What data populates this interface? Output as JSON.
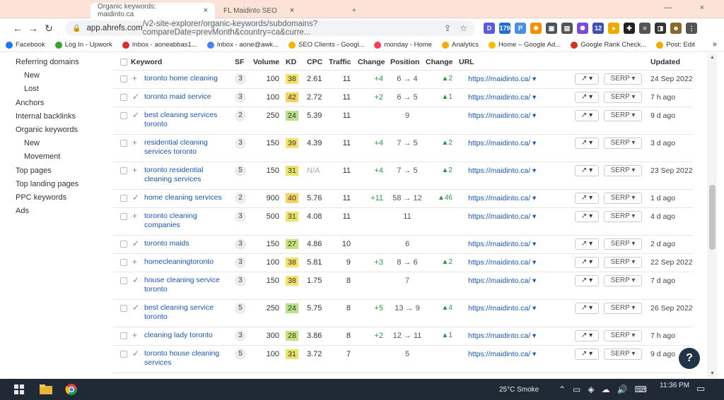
{
  "tabs": [
    {
      "label": "Organic keywords: maidinto.ca",
      "close": "×"
    },
    {
      "label": "FL Maidinto SEO",
      "close": "×"
    },
    {
      "label": "+",
      "close": ""
    }
  ],
  "window_controls": "— ×",
  "address_bar": {
    "url_main": "app.ahrefs.com",
    "url_rest": "/v2-site-explorer/organic-keywords/subdomains?compareDate=prevMonth&country=ca&curre..."
  },
  "extensions": [
    {
      "label": "D",
      "color": "#5a5ae0"
    },
    {
      "label": "179",
      "color": "#1f6fd0"
    },
    {
      "label": "P",
      "color": "#4a90e2"
    },
    {
      "label": "✱",
      "color": "#f29100"
    },
    {
      "label": "▣",
      "color": "#4a5560"
    },
    {
      "label": "▤",
      "color": "#555"
    },
    {
      "label": "✺",
      "color": "#7a4ad8"
    },
    {
      "label": "12",
      "color": "#3f51b5"
    },
    {
      "label": "●",
      "color": "#f2a900"
    },
    {
      "label": "✚",
      "color": "#222"
    },
    {
      "label": "≡",
      "color": "#555"
    },
    {
      "label": "◨",
      "color": "#333"
    },
    {
      "label": "☻",
      "color": "#8a6a2a"
    },
    {
      "label": "⋮",
      "color": "#555"
    }
  ],
  "bookmarks": [
    {
      "label": "Facebook",
      "color": "#1877f2"
    },
    {
      "label": "Log In - Upwork",
      "color": "#3aa02e"
    },
    {
      "label": "Inbox - aoneabbas1...",
      "color": "#d93025"
    },
    {
      "label": "Inbox - aone@awk...",
      "color": "#4285f4"
    },
    {
      "label": "SEO Clients - Googl...",
      "color": "#f4b400"
    },
    {
      "label": "monday - Home",
      "color": "#ff3d57"
    },
    {
      "label": "Analytics",
      "color": "#f9ab00"
    },
    {
      "label": "Home – Google Ad...",
      "color": "#fbbc04"
    },
    {
      "label": "Google Rank Check...",
      "color": "#d93025"
    },
    {
      "label": "Post: Edit",
      "color": "#f2a900"
    }
  ],
  "bookmarks_more": "»",
  "sidebar": [
    {
      "label": "Referring domains",
      "sub": false
    },
    {
      "label": "New",
      "sub": true
    },
    {
      "label": "Lost",
      "sub": true
    },
    {
      "label": "Anchors",
      "sub": false
    },
    {
      "label": "Internal backlinks",
      "sub": false
    },
    {
      "label": "Organic keywords",
      "sub": false
    },
    {
      "label": "New",
      "sub": true
    },
    {
      "label": "Movement",
      "sub": true
    },
    {
      "label": "Top pages",
      "sub": false
    },
    {
      "label": "Top landing pages",
      "sub": false
    },
    {
      "label": "PPC keywords",
      "sub": false
    },
    {
      "label": "Ads",
      "sub": false
    }
  ],
  "table": {
    "headers": {
      "keyword": "Keyword",
      "sf": "SF",
      "volume": "Volume",
      "kd": "KD",
      "cpc": "CPC",
      "traffic": "Traffic",
      "change": "Change",
      "position": "Position",
      "pos_change": "Change",
      "url": "URL",
      "updated": "Updated"
    },
    "trend_label": "↗ ▾",
    "serp_label": "SERP ▾",
    "rows": [
      {
        "keyword": "toronto home cleaning",
        "mark": "+",
        "sf": "3",
        "volume": "100",
        "kd": "38",
        "kd_color": "#f4e06a",
        "cpc": "2.61",
        "traffic": "11",
        "change": "+4",
        "position": "6 → 4",
        "pos_change": "▲2",
        "url": "https://maidinto.ca/ ▾",
        "updated": "24 Sep 2022"
      },
      {
        "keyword": "toronto maid service",
        "mark": "✓",
        "sf": "3",
        "volume": "100",
        "kd": "42",
        "kd_color": "#f4d35e",
        "cpc": "2.72",
        "traffic": "11",
        "change": "+2",
        "position": "6 → 5",
        "pos_change": "▲1",
        "url": "https://maidinto.ca/ ▾",
        "updated": "7 h ago"
      },
      {
        "keyword": "best cleaning services toronto",
        "mark": "✓",
        "sf": "2",
        "volume": "250",
        "kd": "24",
        "kd_color": "#b8e08a",
        "cpc": "5.39",
        "traffic": "11",
        "change": "",
        "position": "9",
        "pos_change": "",
        "url": "https://maidinto.ca/ ▾",
        "updated": "9 d ago"
      },
      {
        "keyword": "residential cleaning services toronto",
        "mark": "+",
        "sf": "3",
        "volume": "150",
        "kd": "39",
        "kd_color": "#f4e06a",
        "cpc": "4.39",
        "traffic": "11",
        "change": "+4",
        "position": "7 → 5",
        "pos_change": "▲2",
        "url": "https://maidinto.ca/ ▾",
        "updated": "3 d ago"
      },
      {
        "keyword": "toronto residential cleaning services",
        "mark": "+",
        "sf": "5",
        "volume": "150",
        "kd": "31",
        "kd_color": "#e8e46a",
        "cpc": "N/A",
        "traffic": "11",
        "change": "+4",
        "position": "7 → 5",
        "pos_change": "▲2",
        "url": "https://maidinto.ca/ ▾",
        "updated": "23 Sep 2022"
      },
      {
        "keyword": "home cleaning services",
        "mark": "✓",
        "sf": "2",
        "volume": "900",
        "kd": "40",
        "kd_color": "#f4d35e",
        "cpc": "5.76",
        "traffic": "11",
        "change": "+11",
        "position": "58 → 12",
        "pos_change": "▲46",
        "url": "https://maidinto.ca/ ▾",
        "updated": "1 d ago"
      },
      {
        "keyword": "toronto cleaning companies",
        "mark": "+",
        "sf": "3",
        "volume": "500",
        "kd": "31",
        "kd_color": "#e8e46a",
        "cpc": "4.08",
        "traffic": "11",
        "change": "",
        "position": "11",
        "pos_change": "",
        "url": "https://maidinto.ca/ ▾",
        "updated": "4 d ago"
      },
      {
        "keyword": "toronto maids",
        "mark": "✓",
        "sf": "3",
        "volume": "150",
        "kd": "27",
        "kd_color": "#c8e27a",
        "cpc": "4.86",
        "traffic": "10",
        "change": "",
        "position": "6",
        "pos_change": "",
        "url": "https://maidinto.ca/ ▾",
        "updated": "2 d ago"
      },
      {
        "keyword": "homecleaningtoronto",
        "mark": "+",
        "sf": "3",
        "volume": "100",
        "kd": "38",
        "kd_color": "#f4e06a",
        "cpc": "5.81",
        "traffic": "9",
        "change": "+3",
        "position": "8 → 6",
        "pos_change": "▲2",
        "url": "https://maidinto.ca/ ▾",
        "updated": "22 Sep 2022"
      },
      {
        "keyword": "house cleaning service toronto",
        "mark": "✓",
        "sf": "3",
        "volume": "150",
        "kd": "38",
        "kd_color": "#f4e06a",
        "cpc": "1.75",
        "traffic": "8",
        "change": "",
        "position": "7",
        "pos_change": "",
        "url": "https://maidinto.ca/ ▾",
        "updated": "7 d ago"
      },
      {
        "keyword": "best cleaning service toronto",
        "mark": "✓",
        "sf": "5",
        "volume": "250",
        "kd": "24",
        "kd_color": "#b8e08a",
        "cpc": "5.75",
        "traffic": "8",
        "change": "+5",
        "position": "13 → 9",
        "pos_change": "▲4",
        "url": "https://maidinto.ca/ ▾",
        "updated": "26 Sep 2022"
      },
      {
        "keyword": "cleaning lady toronto",
        "mark": "+",
        "sf": "3",
        "volume": "300",
        "kd": "28",
        "kd_color": "#c8e27a",
        "cpc": "3.86",
        "traffic": "8",
        "change": "+2",
        "position": "12 → 11",
        "pos_change": "▲1",
        "url": "https://maidinto.ca/ ▾",
        "updated": "7 h ago"
      },
      {
        "keyword": "toronto house cleaning services",
        "mark": "✓",
        "sf": "5",
        "volume": "100",
        "kd": "31",
        "kd_color": "#e8e46a",
        "cpc": "3.72",
        "traffic": "7",
        "change": "",
        "position": "5",
        "pos_change": "",
        "url": "https://maidinto.ca/ ▾",
        "updated": "9 d ago"
      }
    ]
  },
  "help_label": "?",
  "taskbar": {
    "weather": "25°C  Smoke",
    "time": "11:36 PM"
  }
}
